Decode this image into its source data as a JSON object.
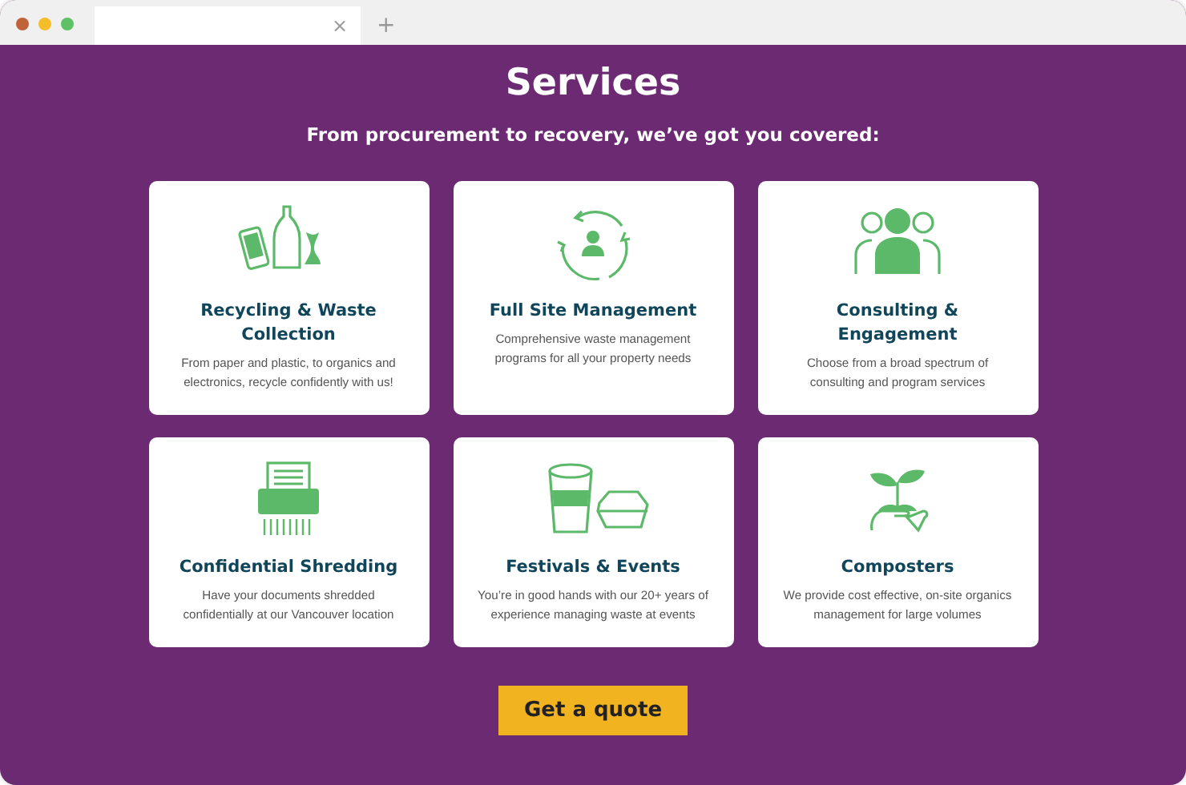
{
  "browser": {
    "tab": {
      "close": "×"
    },
    "new_tab": "+"
  },
  "title": "Services",
  "subtitle": "From procurement to recovery, we’ve got you covered:",
  "services": [
    {
      "kind": "recycling",
      "title": "Recycling & Waste Collection",
      "text": "From paper and plastic, to organics and electronics, recycle confidently with us!"
    },
    {
      "kind": "management",
      "title": "Full Site Management",
      "text": "Comprehensive waste management programs for all your property needs"
    },
    {
      "kind": "people",
      "title": "Consulting & Engagement",
      "text": "Choose from a broad spectrum of consulting and program services"
    },
    {
      "kind": "shredder",
      "title": "Confidential Shredding",
      "text": "Have your documents shredded confidentially at our Vancouver location"
    },
    {
      "kind": "cups",
      "title": "Festivals & Events",
      "text": "You’re in good hands with our 20+ years of experience managing waste at events"
    },
    {
      "kind": "plant",
      "title": "Composters",
      "text": "We provide cost effective, on-site organics management for large volumes"
    }
  ],
  "button": "Get a quote"
}
